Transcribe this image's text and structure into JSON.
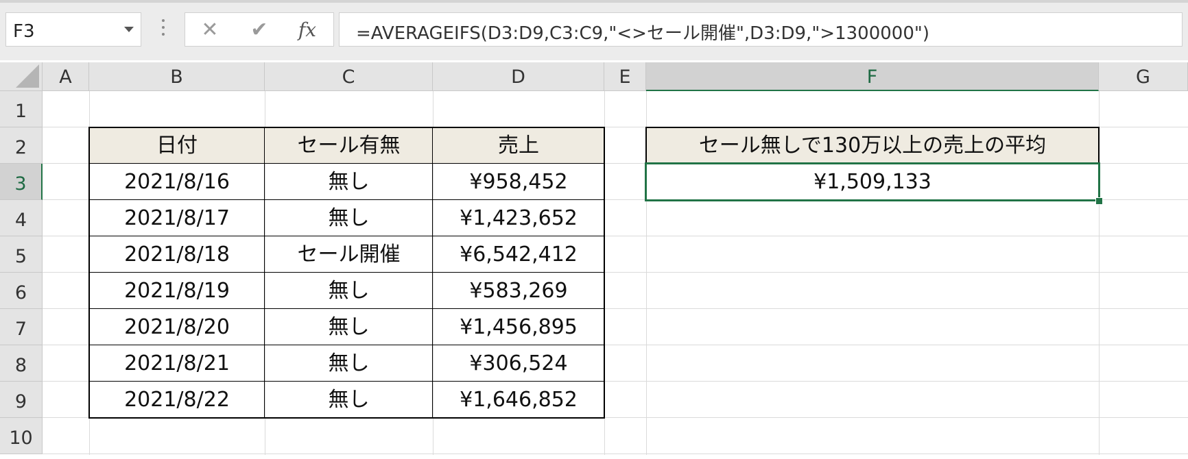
{
  "name_box": {
    "value": "F3"
  },
  "formula_bar": {
    "cancel_symbol": "✕",
    "enter_symbol": "✔",
    "fx_symbol": "fx",
    "formula": "=AVERAGEIFS(D3:D9,C3:C9,\"<>セール開催\",D3:D9,\">1300000\")"
  },
  "sheet": {
    "columns": [
      "A",
      "B",
      "C",
      "D",
      "E",
      "F",
      "G"
    ],
    "rows": [
      "1",
      "2",
      "3",
      "4",
      "5",
      "6",
      "7",
      "8",
      "9",
      "10"
    ],
    "selected_column": "F",
    "selected_row": "3",
    "table": {
      "headers": [
        "日付",
        "セール有無",
        "売上"
      ],
      "rows": [
        [
          "2021/8/16",
          "無し",
          "¥958,452"
        ],
        [
          "2021/8/17",
          "無し",
          "¥1,423,652"
        ],
        [
          "2021/8/18",
          "セール開催",
          "¥6,542,412"
        ],
        [
          "2021/8/19",
          "無し",
          "¥583,269"
        ],
        [
          "2021/8/20",
          "無し",
          "¥1,456,895"
        ],
        [
          "2021/8/21",
          "無し",
          "¥306,524"
        ],
        [
          "2021/8/22",
          "無し",
          "¥1,646,852"
        ]
      ]
    },
    "result": {
      "label": "セール無しで130万以上の売上の平均",
      "value": "¥1,509,133"
    }
  },
  "colors": {
    "accent": "#217346",
    "header_fill": "#efebe1"
  }
}
